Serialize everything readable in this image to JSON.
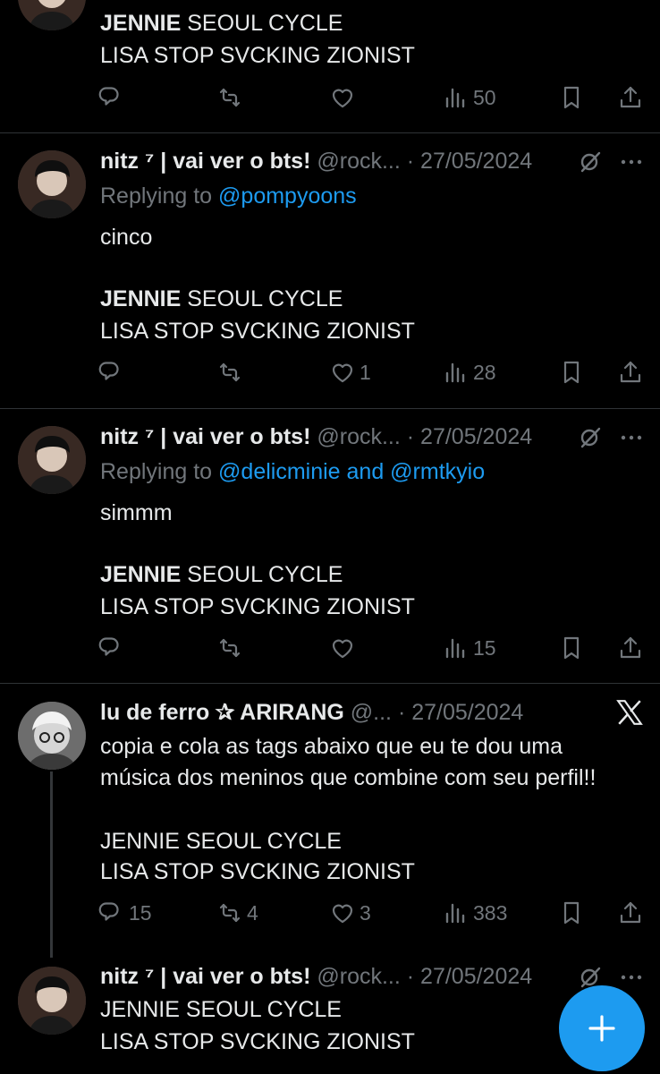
{
  "top_tweet": {
    "line1_bold": "JENNIE",
    "line1_rest": " SEOUL CYCLE",
    "line2": "LISA STOP SVCKING ZIONIST",
    "views": "50"
  },
  "tweets": [
    {
      "name": "nitz ⁷ | vai ver o bts!",
      "handle": "@rock...",
      "sep": " · ",
      "date": "27/05/2024",
      "replying_prefix": "Replying to ",
      "replying_to": "@pompyoons",
      "body": "cinco",
      "line1_bold": "JENNIE",
      "line1_rest": " SEOUL CYCLE",
      "line2": "LISA STOP SVCKING ZIONIST",
      "replies": "",
      "reposts": "",
      "likes": "1",
      "views": "28"
    },
    {
      "name": "nitz ⁷ | vai ver o bts!",
      "handle": "@rock...",
      "sep": " · ",
      "date": "27/05/2024",
      "replying_prefix": "Replying to ",
      "replying_to": "@delicminie and @rmtkyio",
      "body": "simmm",
      "line1_bold": "JENNIE",
      "line1_rest": " SEOUL CYCLE",
      "line2": "LISA STOP SVCKING ZIONIST",
      "replies": "",
      "reposts": "",
      "likes": "",
      "views": "15"
    },
    {
      "name": "lu de ferro ✰ ARIRANG",
      "handle": "@...",
      "sep": " · ",
      "date": "27/05/2024",
      "body1": "copia e cola as tags abaixo que eu te dou uma",
      "body2": "música dos meninos que combine com seu perfil!!",
      "line1": "JENNIE SEOUL CYCLE",
      "line2": "LISA STOP SVCKING ZIONIST",
      "replies": "15",
      "reposts": "4",
      "likes": "3",
      "views": "383"
    },
    {
      "name": "nitz ⁷ | vai ver o bts!",
      "handle": "@rock...",
      "sep": " · ",
      "date": "27/05/2024",
      "line1": "JENNIE SEOUL CYCLE",
      "line2": "LISA STOP SVCKING ZIONIST"
    }
  ],
  "icons": {
    "reply": "reply-icon",
    "repost": "repost-icon",
    "like": "heart-icon",
    "views": "views-icon",
    "bookmark": "bookmark-icon",
    "share": "share-icon",
    "more": "more-icon",
    "grok": "grok-icon",
    "x_logo": "x-logo-icon",
    "compose": "compose-plus-icon"
  },
  "colors": {
    "background": "#000000",
    "text": "#e7e9ea",
    "muted": "#71767b",
    "link": "#1d9bf0",
    "fab": "#1d9bf0"
  }
}
